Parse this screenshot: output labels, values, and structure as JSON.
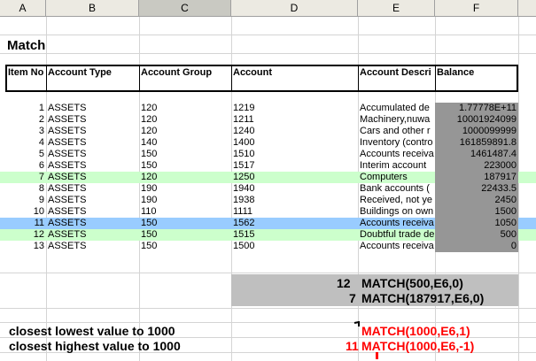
{
  "columns": [
    "A",
    "B",
    "C",
    "D",
    "E",
    "F"
  ],
  "title": "Match",
  "headers": {
    "item_no": "Item No",
    "account_type": "Account Type",
    "account_group": "Account Group",
    "account": "Account",
    "account_description": "Account Descri",
    "balance": "Balance"
  },
  "rows": [
    {
      "item": "1",
      "type": "ASSETS",
      "group": "120",
      "account": "1219",
      "desc": "Accumulated  de",
      "balance": "1.77778E+11",
      "highlight": "none"
    },
    {
      "item": "2",
      "type": "ASSETS",
      "group": "120",
      "account": "1211",
      "desc": "Machinery,nuwa",
      "balance": "10001924099",
      "highlight": "none"
    },
    {
      "item": "3",
      "type": "ASSETS",
      "group": "120",
      "account": "1240",
      "desc": "Cars and other r",
      "balance": "1000099999",
      "highlight": "none"
    },
    {
      "item": "4",
      "type": "ASSETS",
      "group": "140",
      "account": "1400",
      "desc": "Inventory (contro",
      "balance": "161859891.8",
      "highlight": "none"
    },
    {
      "item": "5",
      "type": "ASSETS",
      "group": "150",
      "account": "1510",
      "desc": "Accounts receiva",
      "balance": "1461487.4",
      "highlight": "none"
    },
    {
      "item": "6",
      "type": "ASSETS",
      "group": "150",
      "account": "1517",
      "desc": "Interim account",
      "balance": "223000",
      "highlight": "none"
    },
    {
      "item": "7",
      "type": "ASSETS",
      "group": "120",
      "account": "1250",
      "desc": "Computers",
      "balance": "187917",
      "highlight": "green"
    },
    {
      "item": "8",
      "type": "ASSETS",
      "group": "190",
      "account": "1940",
      "desc": "Bank accounts (",
      "balance": "22433.5",
      "highlight": "none"
    },
    {
      "item": "9",
      "type": "ASSETS",
      "group": "190",
      "account": "1938",
      "desc": "Received, not ye",
      "balance": "2450",
      "highlight": "none"
    },
    {
      "item": "10",
      "type": "ASSETS",
      "group": "110",
      "account": "1111",
      "desc": "Buildings on own",
      "balance": "1500",
      "highlight": "none"
    },
    {
      "item": "11",
      "type": "ASSETS",
      "group": "150",
      "account": "1562",
      "desc": "Accounts receiva",
      "balance": "1050",
      "highlight": "blue"
    },
    {
      "item": "12",
      "type": "ASSETS",
      "group": "150",
      "account": "1515",
      "desc": "Doubtful trade de",
      "balance": "500",
      "highlight": "green"
    },
    {
      "item": "13",
      "type": "ASSETS",
      "group": "150",
      "account": "1500",
      "desc": "Accounts receiva",
      "balance": "0",
      "highlight": "none"
    }
  ],
  "match_results": [
    {
      "value": "12",
      "formula": "MATCH(500,E6,0)"
    },
    {
      "value": "7",
      "formula": "MATCH(187917,E6,0)"
    }
  ],
  "bottom": [
    {
      "label": "closest lowest value to 1000",
      "value": "",
      "formula": "MATCH(1000,E6,1)"
    },
    {
      "label": "closest highest value to 1000",
      "value": "11",
      "formula": "MATCH(1000,E6,-1)"
    }
  ],
  "colors": {
    "header_bg": "#eceae2",
    "selected_header": "#c9c9c2",
    "green_row": "#ccffcc",
    "blue_row": "#99ccff",
    "balance_bg": "#969696",
    "result_block": "#bfbfbf",
    "red": "#ff0000"
  }
}
